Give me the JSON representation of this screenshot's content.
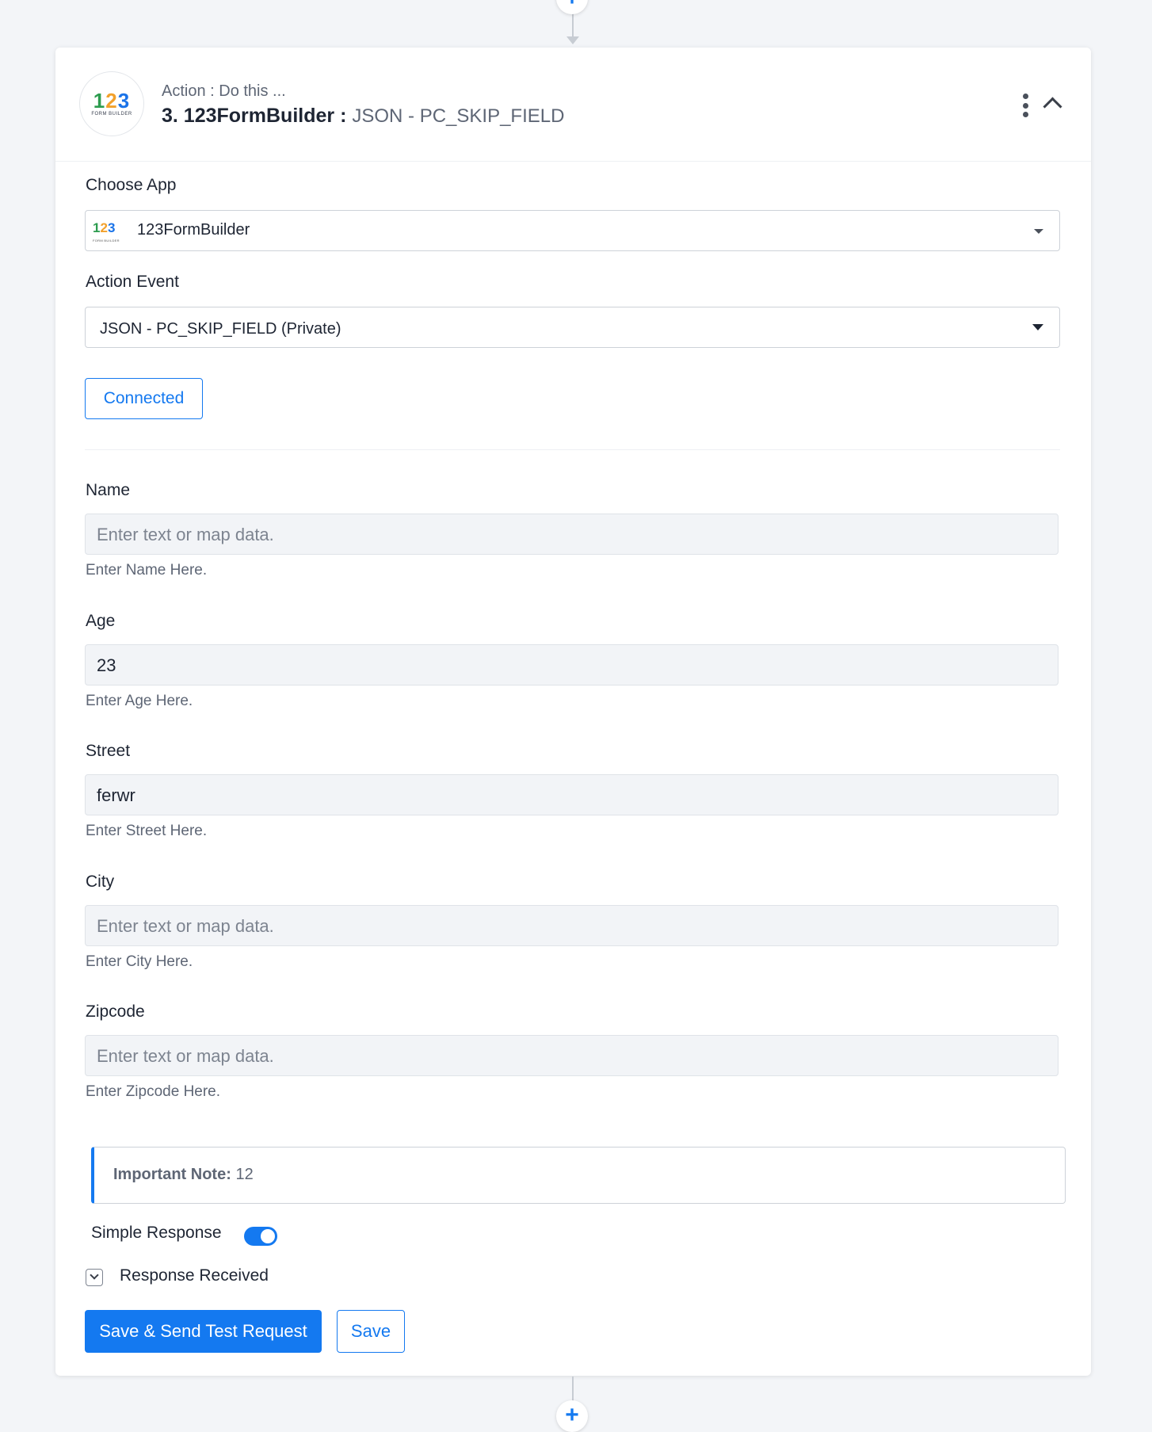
{
  "header": {
    "subtitle": "Action : Do this ...",
    "step_title": "3. 123FormBuilder :",
    "event_name": "JSON - PC_SKIP_FIELD"
  },
  "logo": {
    "digit1": "1",
    "digit2": "2",
    "digit3": "3",
    "subtext": "FORM BUILDER"
  },
  "choose_app": {
    "label": "Choose App",
    "value": "123FormBuilder"
  },
  "action_event": {
    "label": "Action Event",
    "value": "JSON - PC_SKIP_FIELD (Private)"
  },
  "connection": {
    "button_label": "Connected"
  },
  "fields": [
    {
      "label": "Name",
      "value": "",
      "placeholder": "Enter text or map data.",
      "hint": "Enter Name Here."
    },
    {
      "label": "Age",
      "value": "23",
      "placeholder": "Enter text or map data.",
      "hint": "Enter Age Here."
    },
    {
      "label": "Street",
      "value": "ferwr",
      "placeholder": "Enter text or map data.",
      "hint": "Enter Street Here."
    },
    {
      "label": "City",
      "value": "",
      "placeholder": "Enter text or map data.",
      "hint": "Enter City Here."
    },
    {
      "label": "Zipcode",
      "value": "",
      "placeholder": "Enter text or map data.",
      "hint": "Enter Zipcode Here."
    }
  ],
  "note": {
    "title": "Important Note:",
    "text": "12"
  },
  "simple_response": {
    "label": "Simple Response",
    "enabled": true
  },
  "response_received": {
    "label": "Response Received"
  },
  "actions": {
    "primary_label": "Save & Send Test Request",
    "secondary_label": "Save"
  },
  "colors": {
    "accent": "#1479f0",
    "page_bg": "#f3f5f8"
  },
  "connectors": {
    "plus": "+"
  }
}
